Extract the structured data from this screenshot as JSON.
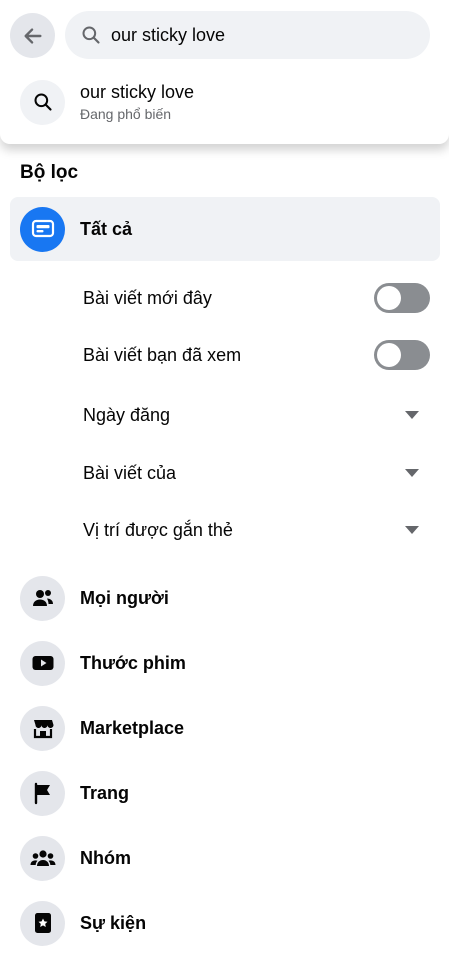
{
  "search": {
    "query": "our sticky love",
    "suggestion": {
      "title": "our sticky love",
      "subtitle": "Đang phổ biến"
    }
  },
  "filters": {
    "heading": "Bộ lọc",
    "all": {
      "label": "Tất cả",
      "icon": "posts-card-icon",
      "selected": true
    },
    "options": [
      {
        "label": "Bài viết mới đây",
        "control": "toggle",
        "on": false
      },
      {
        "label": "Bài viết bạn đã xem",
        "control": "toggle",
        "on": false
      },
      {
        "label": "Ngày đăng",
        "control": "dropdown"
      },
      {
        "label": "Bài viết của",
        "control": "dropdown"
      },
      {
        "label": "Vị trí được gắn thẻ",
        "control": "dropdown"
      }
    ],
    "categories": [
      {
        "label": "Mọi người",
        "icon": "people-icon"
      },
      {
        "label": "Thước phim",
        "icon": "video-play-icon"
      },
      {
        "label": "Marketplace",
        "icon": "marketplace-shop-icon"
      },
      {
        "label": "Trang",
        "icon": "flag-icon"
      },
      {
        "label": "Nhóm",
        "icon": "groups-icon"
      },
      {
        "label": "Sự kiện",
        "icon": "event-star-icon"
      }
    ]
  },
  "colors": {
    "accent": "#1877f2",
    "toggle_off": "#8a8d91",
    "icon_bg": "#e4e6eb",
    "selected_bg": "#f0f2f5"
  }
}
